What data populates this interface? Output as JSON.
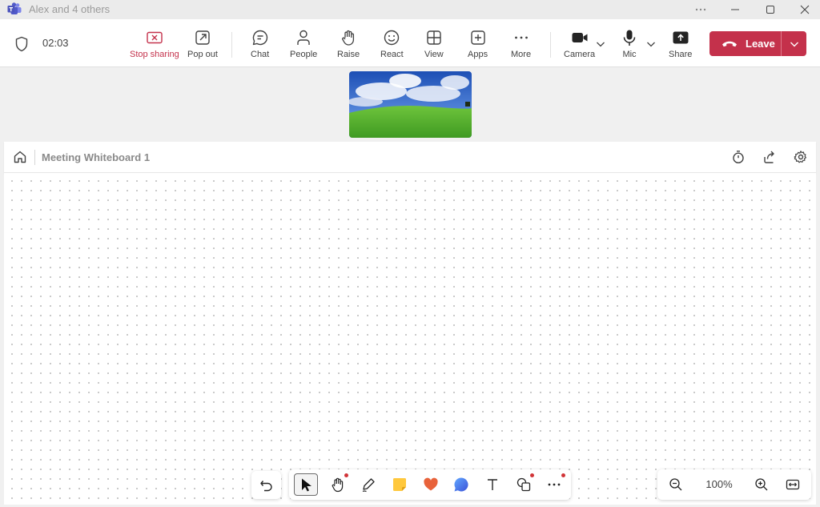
{
  "window": {
    "title": "Alex and 4 others",
    "controls": [
      "more",
      "minimize",
      "maximize",
      "close"
    ]
  },
  "meeting": {
    "timer": "02:03",
    "buttons": {
      "stop_sharing": "Stop sharing",
      "pop_out": "Pop out",
      "chat": "Chat",
      "people": "People",
      "raise": "Raise",
      "react": "React",
      "view": "View",
      "apps": "Apps",
      "more": "More",
      "camera": "Camera",
      "mic": "Mic",
      "share": "Share",
      "leave": "Leave"
    },
    "accent": "#c4314b"
  },
  "whiteboard": {
    "title": "Meeting Whiteboard 1",
    "zoom": "100%",
    "tools": [
      "undo",
      "select",
      "pan",
      "pen",
      "sticky-note",
      "reactions",
      "shapes-bubble",
      "text",
      "shapes",
      "more"
    ]
  }
}
